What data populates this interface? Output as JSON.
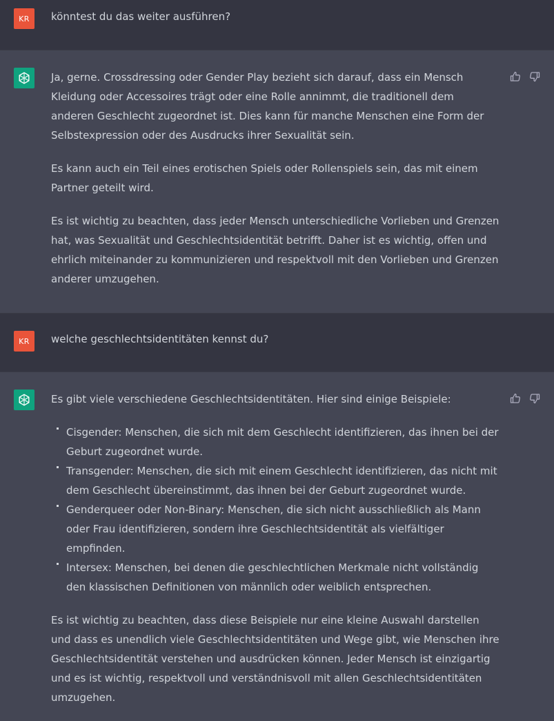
{
  "conversation": [
    {
      "role": "user",
      "avatar": "KR",
      "text": "könntest du das weiter ausführen?"
    },
    {
      "role": "assistant",
      "paragraphs": [
        "Ja, gerne. Crossdressing oder Gender Play bezieht sich darauf, dass ein Mensch Kleidung oder Accessoires trägt oder eine Rolle annimmt, die traditionell dem anderen Geschlecht zugeordnet ist. Dies kann für manche Menschen eine Form der Selbstexpression oder des Ausdrucks ihrer Sexualität sein.",
        "Es kann auch ein Teil eines erotischen Spiels oder Rollenspiels sein, das mit einem Partner geteilt wird.",
        "Es ist wichtig zu beachten, dass jeder Mensch unterschiedliche Vorlieben und Grenzen hat, was Sexualität und Geschlechtsidentität betrifft. Daher ist es wichtig, offen und ehrlich miteinander zu kommunizieren und respektvoll mit den Vorlieben und Grenzen anderer umzugehen."
      ]
    },
    {
      "role": "user",
      "avatar": "KR",
      "text": "welche geschlechtsidentitäten kennst du?"
    },
    {
      "role": "assistant",
      "intro": "Es gibt viele verschiedene Geschlechtsidentitäten. Hier sind einige Beispiele:",
      "list": [
        "Cisgender: Menschen, die sich mit dem Geschlecht identifizieren, das ihnen bei der Geburt zugeordnet wurde.",
        "Transgender: Menschen, die sich mit einem Geschlecht identifizieren, das nicht mit dem Geschlecht übereinstimmt, das ihnen bei der Geburt zugeordnet wurde.",
        "Genderqueer oder Non-Binary: Menschen, die sich nicht ausschließlich als Mann oder Frau identifizieren, sondern ihre Geschlechtsidentität als vielfältiger empfinden.",
        "Intersex: Menschen, bei denen die geschlechtlichen Merkmale nicht vollständig den klassischen Definitionen von männlich oder weiblich entsprechen."
      ],
      "outro": "Es ist wichtig zu beachten, dass diese Beispiele nur eine kleine Auswahl darstellen und dass es unendlich viele Geschlechtsidentitäten und Wege gibt, wie Menschen ihre Geschlechtsidentität verstehen und ausdrücken können. Jeder Mensch ist einzigartig und es ist wichtig, respektvoll und verständnisvoll mit allen Geschlechtsidentitäten umzugehen."
    }
  ],
  "icons": {
    "assistant_avatar": "openai-logo-icon",
    "thumbs_up": "thumbs-up-icon",
    "thumbs_down": "thumbs-down-icon"
  },
  "colors": {
    "user_bg": "#343541",
    "assistant_bg": "#444654",
    "user_avatar": "#e9543a",
    "assistant_avatar": "#10a37f",
    "text": "#d1d5db"
  }
}
